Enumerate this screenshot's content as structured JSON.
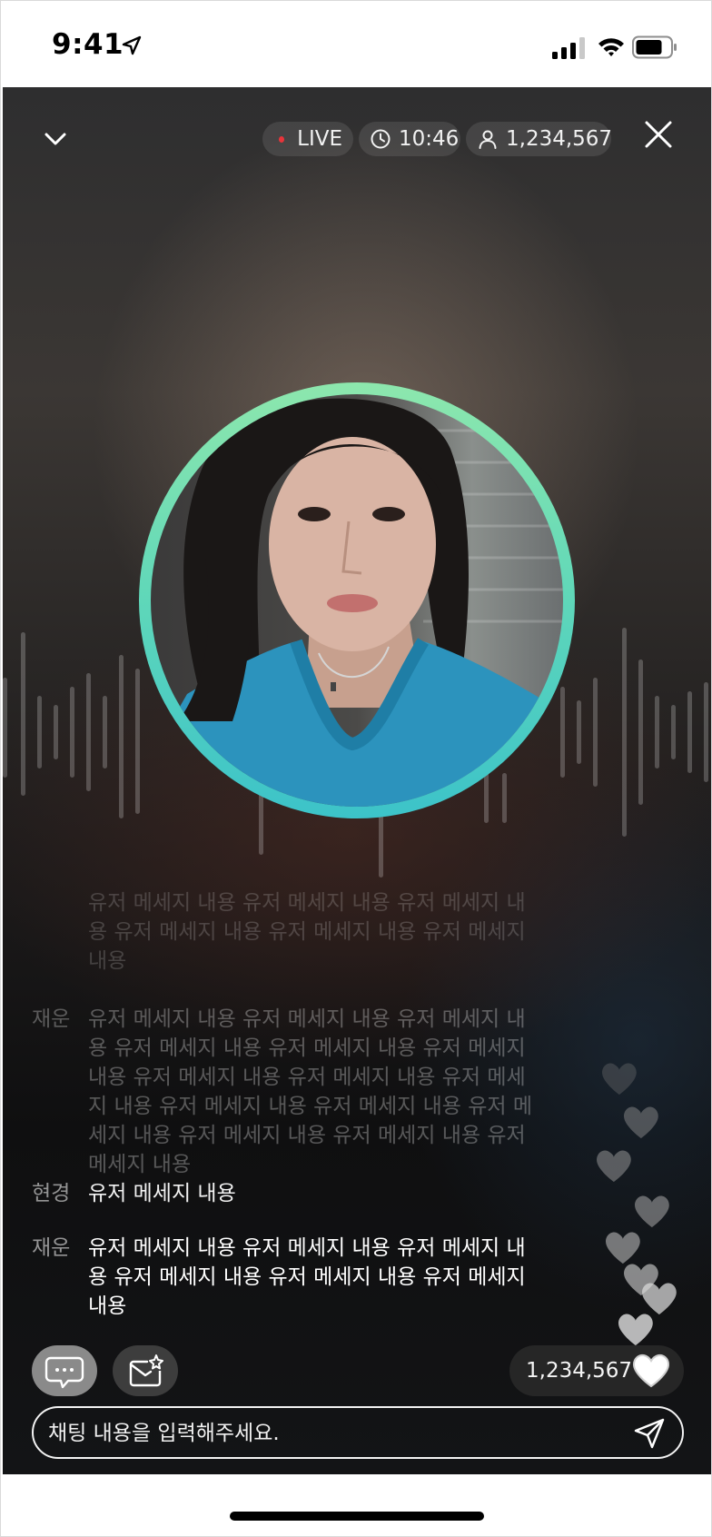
{
  "status_bar": {
    "time": "9:41"
  },
  "header": {
    "live_label": "LIVE",
    "duration": "10:46",
    "viewer_count": "1,234,567"
  },
  "chat": {
    "messages": [
      {
        "nick": "",
        "text": "유저 메세지 내용 유저 메세지 내용 유저 메세지 내용 유저 메세지 내용 유저 메세지 내용 유저 메세지 내용"
      },
      {
        "nick": "재운",
        "text": "유저 메세지 내용 유저 메세지 내용 유저 메세지 내용 유저 메세지 내용 유저 메세지 내용 유저 메세지 내용 유저 메세지 내용 유저 메세지 내용 유저 메세지 내용 유저 메세지 내용 유저 메세지 내용 유저 메세지 내용 유저 메세지 내용 유저 메세지 내용 유저 메세지 내용"
      },
      {
        "nick": "현경",
        "text": "유저 메세지 내용"
      },
      {
        "nick": "재운",
        "text": "유저 메세지 내용 유저 메세지 내용 유저 메세지 내용 유저 메세지 내용 유저 메세지 내용 유저 메세지 내용"
      }
    ]
  },
  "likes": {
    "count": "1,234,567"
  },
  "input": {
    "placeholder": "채팅 내용을 입력해주세요."
  },
  "icons": {
    "collapse": "chevron-down-icon",
    "close": "close-icon",
    "clock": "clock-icon",
    "viewers": "person-icon",
    "chat": "chat-bubble-icon",
    "gift": "gift-envelope-icon",
    "like": "heart-icon",
    "send": "send-icon"
  },
  "colors": {
    "live_dot": "#e8343a",
    "ring_top": "#8de7ad",
    "ring_bottom": "#3cc3c9"
  }
}
